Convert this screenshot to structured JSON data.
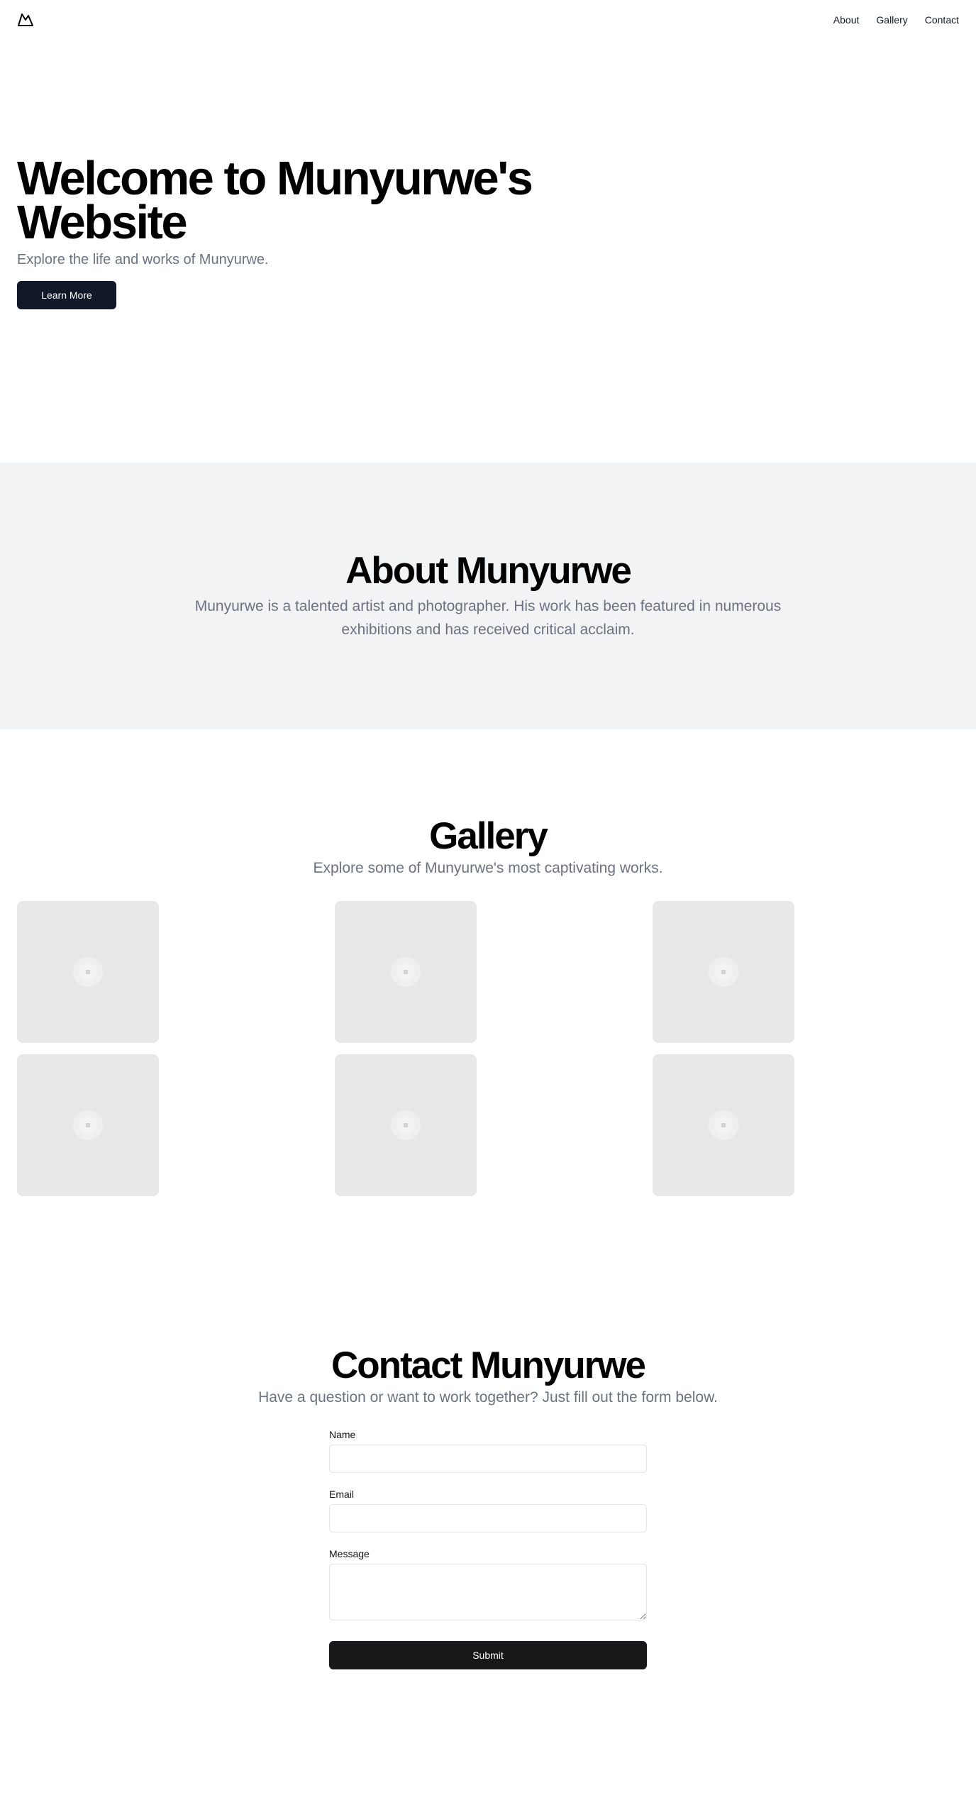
{
  "nav": {
    "items": [
      {
        "label": "About"
      },
      {
        "label": "Gallery"
      },
      {
        "label": "Contact"
      }
    ]
  },
  "hero": {
    "title": "Welcome to Munyurwe's Website",
    "subtitle": "Explore the life and works of Munyurwe.",
    "button_label": "Learn More"
  },
  "about": {
    "title": "About Munyurwe",
    "text": "Munyurwe is a talented artist and photographer. His work has been featured in numerous exhibitions and has received critical acclaim."
  },
  "gallery": {
    "title": "Gallery",
    "subtitle": "Explore some of Munyurwe's most captivating works.",
    "image_icon": "placeholder-image-icon"
  },
  "contact": {
    "title": "Contact Munyurwe",
    "subtitle": "Have a question or want to work together? Just fill out the form below.",
    "name_label": "Name",
    "email_label": "Email",
    "message_label": "Message",
    "submit_label": "Submit"
  },
  "colors": {
    "primary_button": "#111827",
    "submit_button": "#18181b",
    "about_bg": "#f2f3f5",
    "muted_text": "#6b7280",
    "tile_bg": "#e8e8e8"
  }
}
